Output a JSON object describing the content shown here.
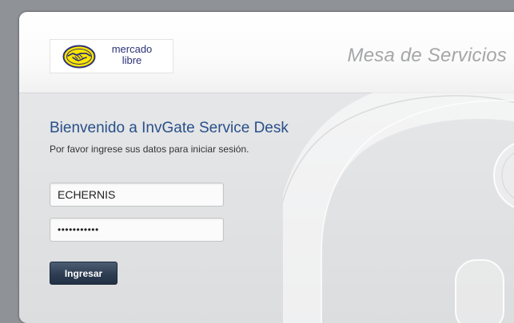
{
  "header": {
    "logo": {
      "line1": "mercado",
      "line2": "libre"
    },
    "app_title": "Mesa de Servicios"
  },
  "login": {
    "welcome": "Bienvenido a InvGate Service Desk",
    "subtitle": "Por favor ingrese sus datos para iniciar sesión.",
    "username_value": "ECHERNIS",
    "password_value": "•••••••••••",
    "submit_label": "Ingresar"
  },
  "icons": {
    "logo": "handshake-icon",
    "watermark": "invgate-watermark-icon"
  },
  "colors": {
    "brand_yellow": "#ffe600",
    "brand_navy": "#2d3277",
    "heading_blue": "#28508a",
    "button_dark": "#2e3d52",
    "title_gray": "#a5a6a8"
  }
}
